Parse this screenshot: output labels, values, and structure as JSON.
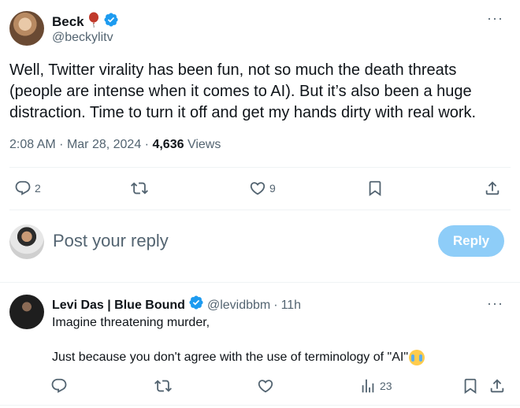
{
  "tweet": {
    "author_name": "Beck",
    "author_handle": "@beckylitv",
    "more_label": "···",
    "text": "Well, Twitter virality has been fun, not so much the death threats (people are intense when it comes to AI). But it’s also been a huge distraction. Time to turn it off and get my hands dirty with real work.",
    "time": "2:08 AM",
    "date": "Mar 28, 2024",
    "sep": "·",
    "views_count": "4,636",
    "views_label": "Views",
    "replies": "2",
    "likes": "9"
  },
  "reply_box": {
    "placeholder": "Post your reply",
    "button_label": "Reply"
  },
  "comment": {
    "author_name": "Levi Das | Blue Bound",
    "author_handle": "@levidbbm",
    "sep": "·",
    "time": "11h",
    "more_label": "···",
    "line1": "Imagine threatening murder,",
    "line2": "Just because you don't agree with the use of terminology of \"AI\"",
    "views": "23"
  },
  "colors": {
    "accent": "#1d9bf0",
    "reply_button_disabled": "#8ecdf8",
    "muted_text": "#536471",
    "balloon": "#c0392b"
  }
}
